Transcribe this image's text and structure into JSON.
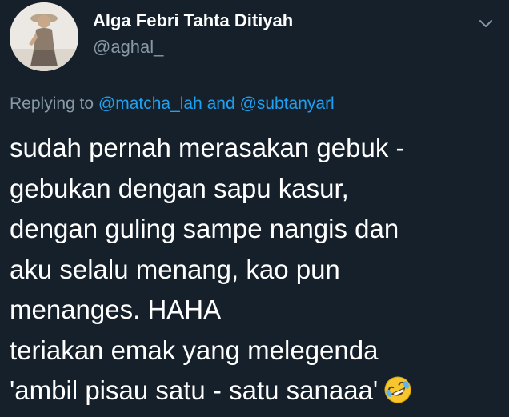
{
  "user": {
    "display_name": "Alga Febri Tahta Ditiyah",
    "handle": "@aghal_",
    "avatar_icon": "profile-photo"
  },
  "menu": {
    "icon": "chevron-down-icon"
  },
  "reply": {
    "prefix": "Replying to ",
    "mention_1": "@matcha_lah",
    "conjunction": " and ",
    "mention_2": "@subtanyarl",
    "mention_color": "#1da1f2"
  },
  "tweet": {
    "lines": [
      "sudah pernah merasakan gebuk -",
      "gebukan dengan sapu kasur,",
      "dengan guling sampe nangis dan",
      "aku selalu menang, kao pun",
      "menanges. HAHA",
      "teriakan emak yang melegenda",
      "'ambil pisau satu - satu sanaaa'"
    ],
    "emoji": "rolling-on-floor-laughing-emoji"
  },
  "colors": {
    "background": "#15202b",
    "text": "#ffffff",
    "secondary": "#8899a6",
    "link": "#1da1f2"
  }
}
